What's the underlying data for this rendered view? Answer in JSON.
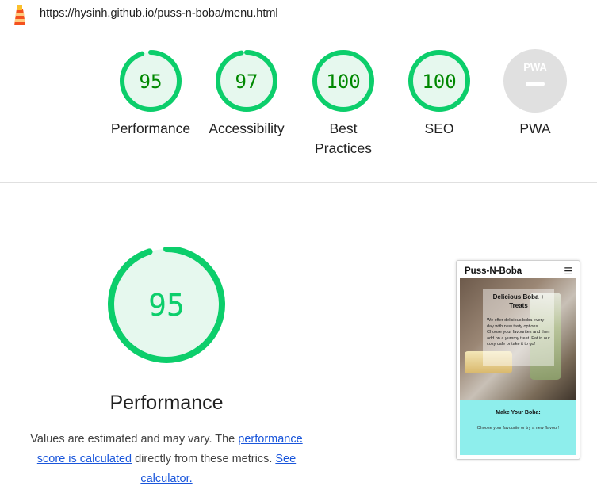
{
  "address_bar": {
    "url": "https://hysinh.github.io/puss-n-boba/menu.html"
  },
  "colors": {
    "pass": "#0cce6b",
    "pass_fill": "#e6f8ee",
    "pass_text": "#008800",
    "na": "#cccccc",
    "na_fill": "#e0e0e0",
    "link": "#1a56db"
  },
  "gauges": [
    {
      "score": "95",
      "label": "Performance",
      "value": 0.95
    },
    {
      "score": "97",
      "label": "Accessibility",
      "value": 0.97
    },
    {
      "score": "100",
      "label": "Best Practices",
      "value": 1.0
    },
    {
      "score": "100",
      "label": "SEO",
      "value": 1.0
    },
    {
      "score": "",
      "label": "PWA",
      "badge": "PWA",
      "icon": "pwa-badge-icon"
    }
  ],
  "performance": {
    "score": "95",
    "value": 0.95,
    "title": "Performance",
    "desc_prefix": "Values are estimated and may vary. The ",
    "desc_link1": "performance score is calculated",
    "desc_middle": " directly from these metrics. ",
    "desc_link2": "See calculator."
  },
  "thumbnail": {
    "site_title": "Puss-N-Boba",
    "hero_title": "Delicious Boba + Treats",
    "hero_text": "We offer delicious boba every day with new tasty options. Choose your favourites and then add on a yummy treat. Eat in our cosy cafe or take it to go!",
    "band_title": "Make Your Boba:",
    "band_text": "Choose your favourite or try a new flavour!"
  }
}
